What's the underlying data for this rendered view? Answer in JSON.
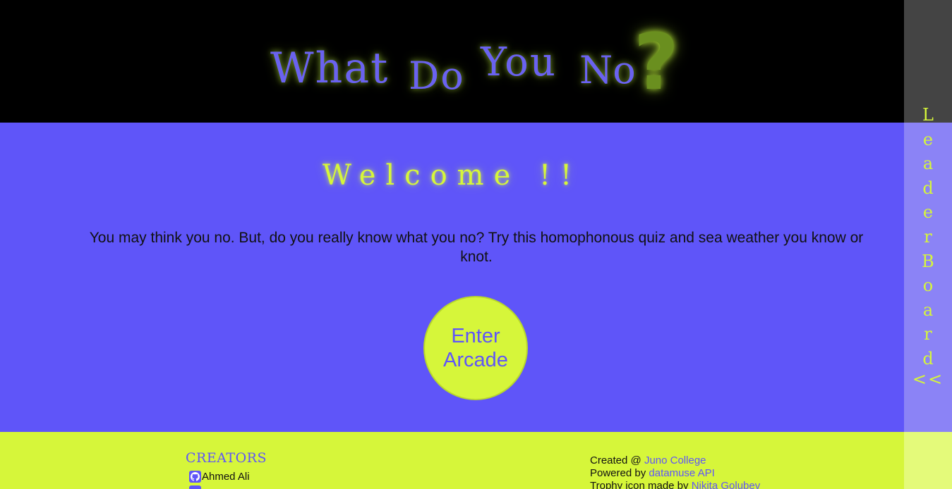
{
  "header": {
    "logo_words": [
      "What",
      "Do",
      "You",
      "No"
    ],
    "logo_mark": "?"
  },
  "main": {
    "welcome": "Welcome !!",
    "intro": "You may think you no. But, do you really know what you no? Try this homophonous quiz and sea weather you know or knot.",
    "enter_button": {
      "line1": "Enter",
      "line2": "Arcade"
    }
  },
  "footer": {
    "creators_title": "CREATORS",
    "creators": [
      {
        "name": "Ahmed Ali",
        "icon": "github-icon"
      }
    ],
    "credits": {
      "created_prefix": "Created @",
      "created_link": "Juno College",
      "powered_prefix": "Powered by",
      "powered_link": "datamuse API",
      "trophy_prefix": "Trophy icon made by",
      "trophy_link": "Nikita Golubev"
    }
  },
  "leaderboard_tab": {
    "letters": [
      "L",
      "e",
      "a",
      "d",
      "e",
      "r",
      "B",
      "o",
      "a",
      "r",
      "d"
    ],
    "arrow": "<<"
  },
  "colors": {
    "primary": "#5f55f9",
    "accent": "#d6f63a",
    "header_bg": "#000000"
  }
}
